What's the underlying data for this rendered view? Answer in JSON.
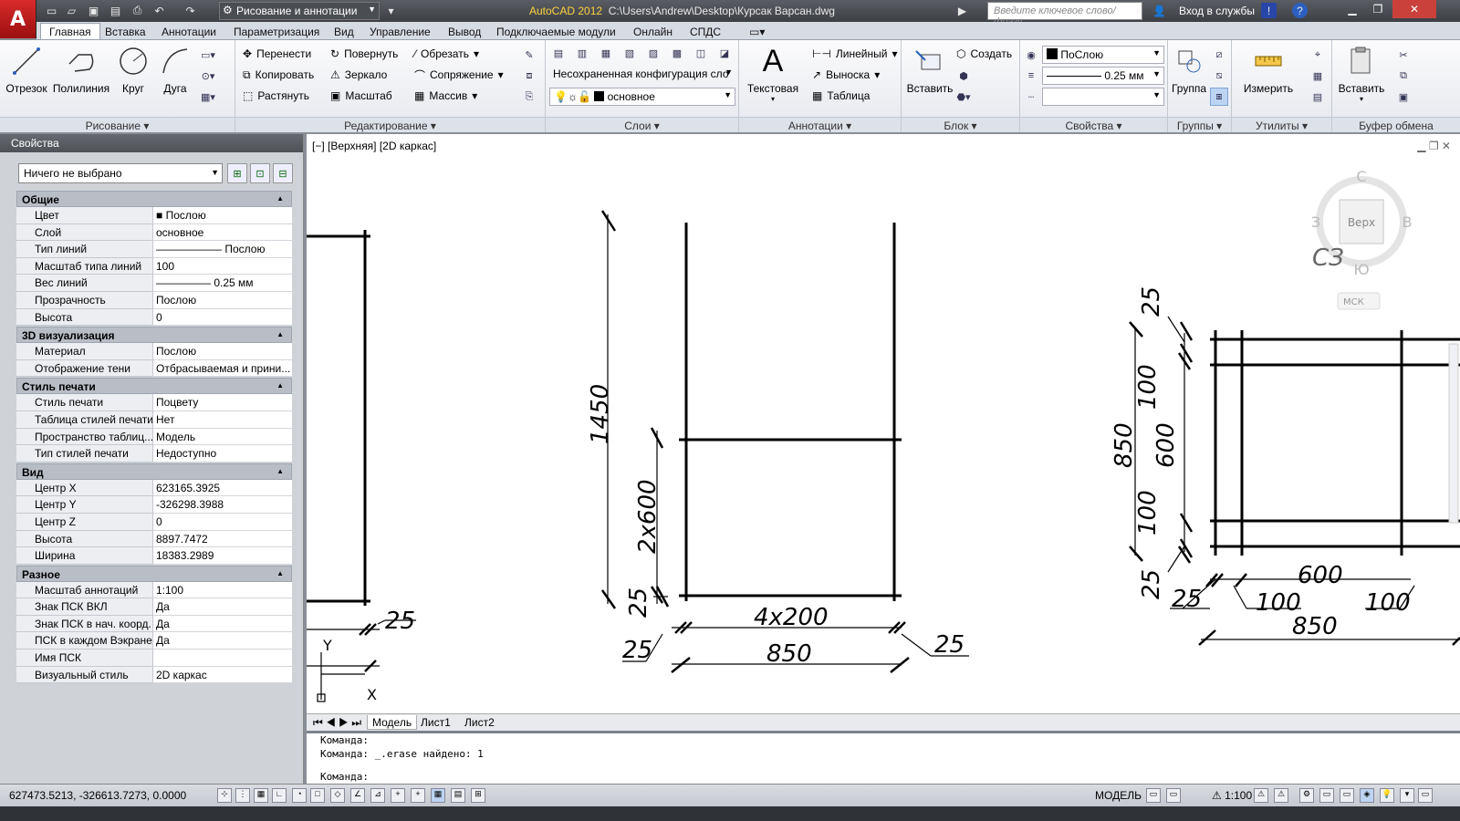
{
  "titlebar": {
    "logo": "A",
    "workspace": "Рисование и аннотации",
    "app": "AutoCAD 2012",
    "path": "C:\\Users\\Andrew\\Desktop\\Курсак Варсан.dwg",
    "search_placeholder": "Введите ключевое слово/фразу",
    "login": "Вход в службы",
    "help": "?"
  },
  "tabs": [
    "Главная",
    "Вставка",
    "Аннотации",
    "Параметризация",
    "Вид",
    "Управление",
    "Вывод",
    "Подключаемые модули",
    "Онлайн",
    "СПДС"
  ],
  "ribbon": {
    "draw": {
      "label": "Рисование",
      "items": [
        "Отрезок",
        "Полилиния",
        "Круг",
        "Дуга"
      ]
    },
    "modify": {
      "label": "Редактирование",
      "col1": [
        "Перенести",
        "Копировать",
        "Растянуть"
      ],
      "col2": [
        "Повернуть",
        "Зеркало",
        "Масштаб"
      ],
      "col3": [
        "Обрезать",
        "Сопряжение",
        "Массив"
      ]
    },
    "layers": {
      "label": "Слои",
      "state": "Несохраненная конфигурация сло",
      "current": "основное"
    },
    "annot": {
      "label": "Аннотации",
      "big": "Текстовая",
      "items": [
        "Линейный",
        "Выноска",
        "Таблица"
      ]
    },
    "block": {
      "label": "Блок",
      "big": "Вставить",
      "create": "Создать"
    },
    "props": {
      "label": "Свойства",
      "color": "ПоСлою",
      "lw": "0.25 мм"
    },
    "groups": {
      "label": "Группы",
      "big": "Группа"
    },
    "util": {
      "label": "Утилиты",
      "big": "Измерить"
    },
    "clip": {
      "label": "Буфер обмена",
      "big": "Вставить"
    }
  },
  "panel": {
    "title": "Свойства",
    "selection": "Ничего не выбрано",
    "cats": [
      {
        "name": "Общие",
        "rows": [
          [
            "Цвет",
            "■ Послою"
          ],
          [
            "Слой",
            "основное"
          ],
          [
            "Тип линий",
            "——————  Послою"
          ],
          [
            "Масштаб типа линий",
            "100"
          ],
          [
            "Вес линий",
            "————— 0.25 мм"
          ],
          [
            "Прозрачность",
            "Послою"
          ],
          [
            "Высота",
            "0"
          ]
        ]
      },
      {
        "name": "3D визуализация",
        "rows": [
          [
            "Материал",
            "Послою"
          ],
          [
            "Отображение тени",
            "Отбрасываемая и прини..."
          ]
        ]
      },
      {
        "name": "Стиль печати",
        "rows": [
          [
            "Стиль печати",
            "Поцвету"
          ],
          [
            "Таблица стилей печати",
            "Нет"
          ],
          [
            "Пространство таблиц...",
            "Модель"
          ],
          [
            "Тип стилей печати",
            "Недоступно"
          ]
        ]
      },
      {
        "name": "Вид",
        "rows": [
          [
            "Центр X",
            "623165.3925"
          ],
          [
            "Центр Y",
            "-326298.3988"
          ],
          [
            "Центр Z",
            "0"
          ],
          [
            "Высота",
            "8897.7472"
          ],
          [
            "Ширина",
            "18383.2989"
          ]
        ]
      },
      {
        "name": "Разное",
        "rows": [
          [
            "Масштаб аннотаций",
            "1:100"
          ],
          [
            "Знак ПСК ВКЛ",
            "Да"
          ],
          [
            "Знак ПСК в нач. коорд.",
            "Да"
          ],
          [
            "ПСК в каждом Вэкране",
            "Да"
          ],
          [
            "Имя ПСК",
            ""
          ],
          [
            "Визуальный стиль",
            "2D каркас"
          ]
        ]
      }
    ]
  },
  "viewport": {
    "label": "[−] [Верхняя] [2D каркас]",
    "cube": {
      "top": "Верх",
      "n": "С",
      "s": "Ю",
      "w": "З",
      "e": "В",
      "sw": "СЗ",
      "ucs": "МСК"
    },
    "dims": {
      "d1450": "1450",
      "d2x600": "2x600",
      "d25a": "25",
      "d4x200": "4x200",
      "d850": "850",
      "d25b": "25",
      "d25c": "25",
      "d25left": "25",
      "d25top": "25",
      "d100a": "100",
      "d850v": "850",
      "d600v": "600",
      "d100b": "100",
      "d25bot": "25",
      "d600h": "600",
      "d25h": "25",
      "d100h1": "100",
      "d100h2": "100",
      "d850h": "850"
    },
    "ucs_y": "Y",
    "ucs_x": "X"
  },
  "layouts": [
    "Модель",
    "Лист1",
    "Лист2"
  ],
  "cmd": [
    "Команда:",
    "Команда: _.erase найдено: 1",
    "Команда:"
  ],
  "status": {
    "coords": "627473.5213, -326613.7273, 0.0000",
    "model": "МОДЕЛЬ",
    "scale": "1:100"
  }
}
